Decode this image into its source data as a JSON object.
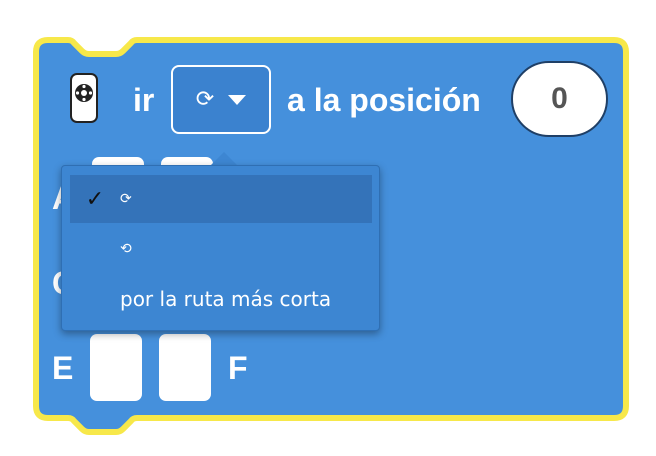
{
  "block": {
    "prefix": "ir",
    "direction_selected": "⟳",
    "middle_text": "a la posición",
    "position_value": "0",
    "port_letters_visible": [
      "A",
      "C",
      "E",
      "F"
    ],
    "colors": {
      "fill": "#4590dc",
      "outline": "#f7e84a",
      "dropdown_fill": "#3b82cf"
    }
  },
  "dropdown_menu": {
    "items": [
      {
        "label": "⟳",
        "checked": true
      },
      {
        "label": "⟲",
        "checked": false
      },
      {
        "label": "por la ruta más corta",
        "checked": false
      }
    ],
    "check_mark": "✓"
  },
  "icons": {
    "motor": "motor-icon",
    "check": "check-icon",
    "caret": "chevron-down-icon"
  }
}
